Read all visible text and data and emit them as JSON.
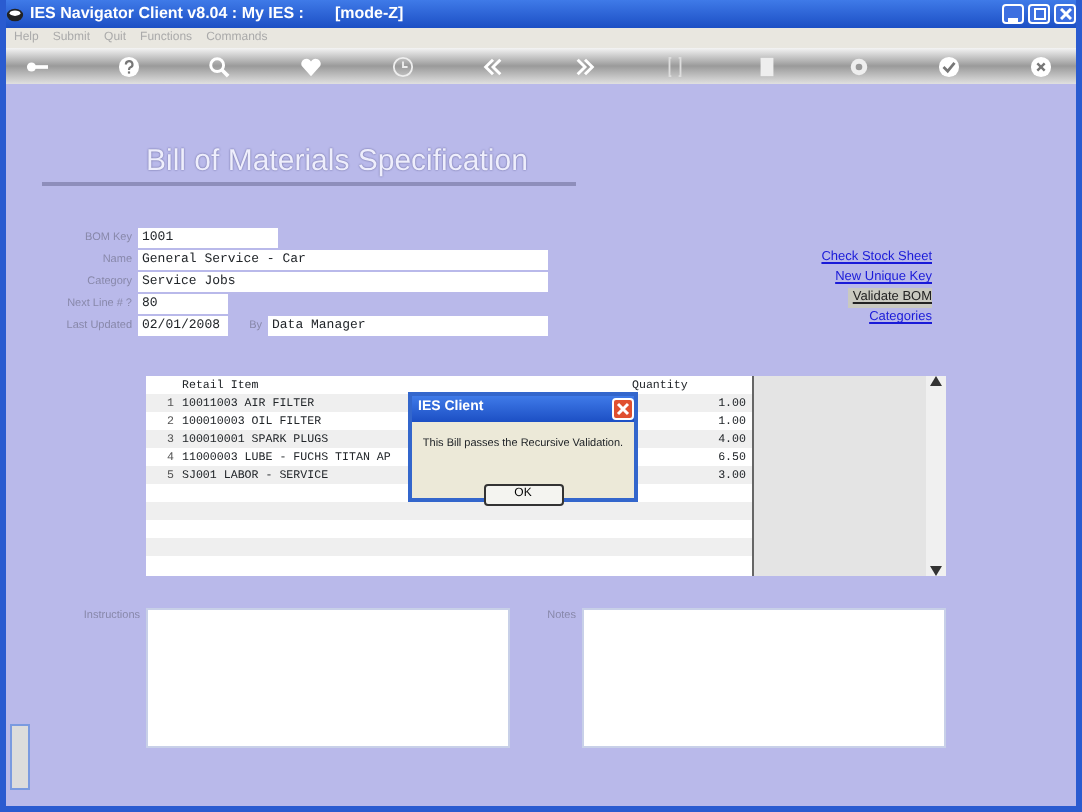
{
  "window": {
    "title": "IES Navigator Client v8.04 : My IES :       [mode-Z]"
  },
  "menu": [
    "Help",
    "Submit",
    "Quit",
    "Functions",
    "Commands"
  ],
  "heading": "Bill of Materials Specification",
  "fields": [
    {
      "label": "BOM Key",
      "value": "1001",
      "kind": "short"
    },
    {
      "label": "Name",
      "value": "General Service - Car",
      "kind": "long"
    },
    {
      "label": "Category",
      "value": "Service Jobs",
      "kind": "long"
    },
    {
      "label": "Next Line # ?",
      "value": "80",
      "kind": "tiny"
    },
    {
      "label": "Last Updated",
      "value": "02/01/2008",
      "kind": "tiny",
      "by_label": "By",
      "by_value": "Data Manager"
    }
  ],
  "links": [
    {
      "label": "Check Stock Sheet",
      "selected": false
    },
    {
      "label": "New Unique Key",
      "selected": false
    },
    {
      "label": "Validate BOM",
      "selected": true
    },
    {
      "label": "Categories",
      "selected": false
    }
  ],
  "table": {
    "columns": [
      "Retail Item",
      "Quantity"
    ],
    "rows": [
      {
        "number": "1",
        "item": "10011003 AIR FILTER",
        "quantity": "1.00"
      },
      {
        "number": "2",
        "item": "100010003 OIL FILTER",
        "quantity": "1.00"
      },
      {
        "number": "3",
        "item": "100010001 SPARK PLUGS",
        "quantity": "4.00"
      },
      {
        "number": "4",
        "item": "11000003 LUBE - FUCHS TITAN AP",
        "quantity": "6.50"
      },
      {
        "number": "5",
        "item": "SJ001 LABOR - SERVICE",
        "quantity": "3.00"
      }
    ]
  },
  "dialog": {
    "title": "IES Client",
    "message": "This Bill passes the Recursive Validation.",
    "button": "OK"
  },
  "instructions": {
    "label": "Instructions"
  },
  "notes": {
    "label": "Notes"
  }
}
